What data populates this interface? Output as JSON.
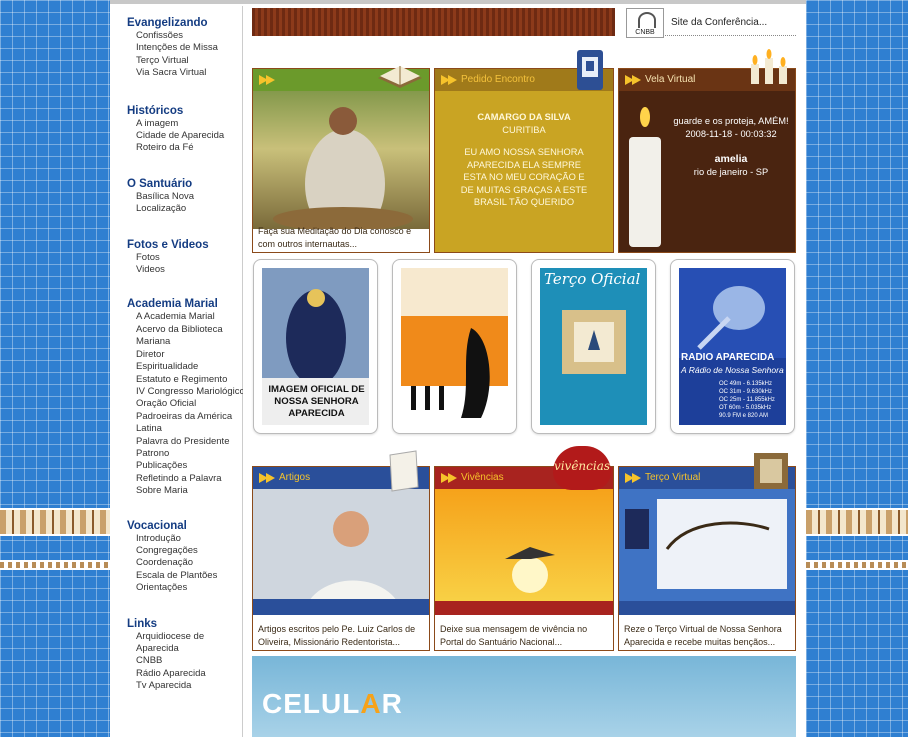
{
  "sidebar": {
    "sections": [
      {
        "title": "Evangelizando",
        "items": [
          "Confissões",
          "Intenções de Missa",
          "Terço Virtual",
          "Via Sacra Virtual"
        ]
      },
      {
        "title": "Históricos",
        "items": [
          "A imagem",
          "Cidade de Aparecida",
          "Roteiro da Fé"
        ]
      },
      {
        "title": "O Santuário",
        "items": [
          "Basílica Nova",
          "Localização"
        ]
      },
      {
        "title": "Fotos e Videos",
        "items": [
          "Fotos",
          "Videos"
        ]
      },
      {
        "title": "Academia Marial",
        "items": [
          "A Academia Marial",
          "Acervo da Biblioteca",
          "Mariana",
          "Diretor",
          "Espiritualidade",
          "Estatuto e Regimento",
          "IV Congresso Mariológico",
          "Oração Oficial",
          "Padroeiras da América",
          "Latina",
          "Palavra do Presidente",
          "Patrono",
          "Publicações",
          "Refletindo a Palavra",
          "Sobre Maria"
        ]
      },
      {
        "title": "Vocacional",
        "items": [
          "Introdução",
          "Congregações",
          "Coordenação",
          "Escala de Plantões",
          "Orientações"
        ]
      },
      {
        "title": "Links",
        "items": [
          "Arquidiocese de",
          "Aparecida",
          "CNBB",
          "Rádio Aparecida",
          "Tv Aparecida"
        ]
      }
    ]
  },
  "header": {
    "conference_link": "Site da Conferência...",
    "cnbb_label": "CNBB"
  },
  "cards_top": {
    "meditation": {
      "caption": "Faça sua Meditação do Dia conosco e com outros internautas..."
    },
    "pedido": {
      "title": "Pedido Encontro",
      "lines": [
        "CAMARGO DA SILVA",
        "CURITIBA",
        "EU AMO NOSSA SENHORA",
        "APARECIDA ELA SEMPRE",
        "ESTA NO MEU CORAÇÃO E",
        "DE MUITAS GRAÇAS A ESTE",
        "BRASIL TÃO QUERIDO"
      ]
    },
    "vela": {
      "title": "Vela Virtual",
      "message": "guarde e os proteja, AMÉM!",
      "datetime": "2008-11-18 - 00:03:32",
      "name": "amelia",
      "place": "rio de janeiro - SP"
    }
  },
  "thumbs": {
    "imagem": {
      "lines": [
        "IMAGEM OFICIAL DE",
        "NOSSA SENHORA",
        "APARECIDA"
      ]
    },
    "terco": {
      "title": "Terço Oficial"
    },
    "radio": {
      "title": "RADIO APARECIDA",
      "subtitle": "A Rádio de Nossa Senhora",
      "freqs": [
        "OC 49m - 6.135kHz",
        "OC 31m - 9.630kHz",
        "OC 25m - 11.855kHz",
        "OT 60m - 5.035kHz",
        "90.9 FM e 820 AM"
      ]
    }
  },
  "cards_bottom": {
    "artigos": {
      "title": "Artigos",
      "caption": "Artigos escritos pelo Pe. Luiz Carlos de Oliveira, Missionário Redentorista..."
    },
    "vivencias": {
      "title": "Vivências",
      "badge": "vivências",
      "caption": "Deixe sua mensagem de vivência no Portal do Santuário Nacional..."
    },
    "terco_virtual": {
      "title": "Terço Virtual",
      "caption": "Reze o Terço Virtual de Nossa Senhora Aparecida e recebe muitas bençãos..."
    }
  },
  "celular": {
    "text_a": "CELUL",
    "text_b": "A",
    "text_c": "R"
  },
  "colors": {
    "brand_blue": "#143c82",
    "accent_gold": "#f6c32b",
    "frame_brown": "#8b4a1a",
    "background_tile": "#2f7fd1"
  }
}
